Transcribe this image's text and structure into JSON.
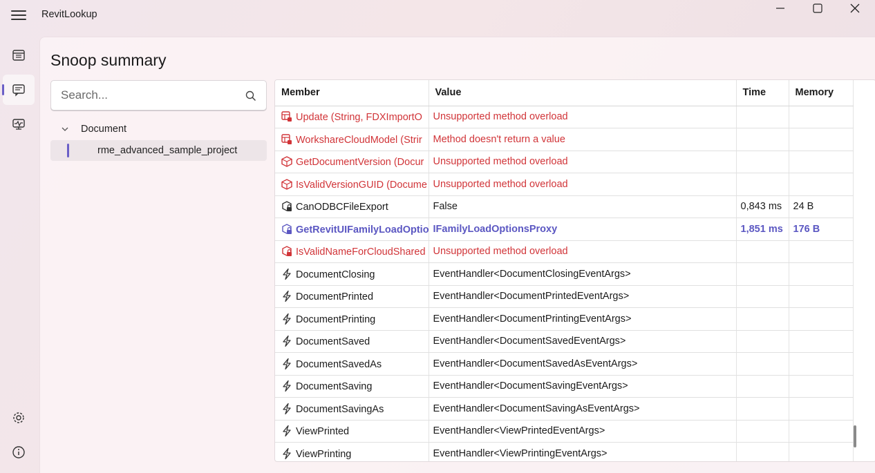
{
  "app": {
    "title": "RevitLookup"
  },
  "page": {
    "title": "Snoop summary"
  },
  "search": {
    "placeholder": "Search..."
  },
  "tree": {
    "root_label": "Document",
    "child_label": "rme_advanced_sample_project"
  },
  "table": {
    "columns": [
      "Member",
      "Value",
      "Time",
      "Memory"
    ],
    "rows": [
      {
        "icon": "method-error-icon",
        "member": "Update (String, FDXImportO",
        "value": "Unsupported method overload",
        "time": "",
        "memory": "",
        "state": "err"
      },
      {
        "icon": "method-error-icon",
        "member": "WorkshareCloudModel (Strir",
        "value": "Method doesn't return a value",
        "time": "",
        "memory": "",
        "state": "err"
      },
      {
        "icon": "static-method-error-icon",
        "member": "GetDocumentVersion (Docur",
        "value": "Unsupported method overload",
        "time": "",
        "memory": "",
        "state": "err"
      },
      {
        "icon": "static-method-error-icon",
        "member": "IsValidVersionGUID (Docume",
        "value": "Unsupported method overload",
        "time": "",
        "memory": "",
        "state": "err"
      },
      {
        "icon": "locked-method-icon",
        "member": "CanODBCFileExport",
        "value": "False",
        "time": "0,843 ms",
        "memory": "24 B",
        "state": "normal"
      },
      {
        "icon": "locked-method-icon",
        "member": "GetRevitUIFamilyLoadOptio",
        "value": "IFamilyLoadOptionsProxy",
        "time": "1,851 ms",
        "memory": "176 B",
        "state": "hl"
      },
      {
        "icon": "locked-method-icon",
        "member": "IsValidNameForCloudShared",
        "value": "Unsupported method overload",
        "time": "",
        "memory": "",
        "state": "err"
      },
      {
        "icon": "event-icon",
        "member": "DocumentClosing",
        "value": "EventHandler<DocumentClosingEventArgs>",
        "time": "",
        "memory": "",
        "state": "normal"
      },
      {
        "icon": "event-icon",
        "member": "DocumentPrinted",
        "value": "EventHandler<DocumentPrintedEventArgs>",
        "time": "",
        "memory": "",
        "state": "normal"
      },
      {
        "icon": "event-icon",
        "member": "DocumentPrinting",
        "value": "EventHandler<DocumentPrintingEventArgs>",
        "time": "",
        "memory": "",
        "state": "normal"
      },
      {
        "icon": "event-icon",
        "member": "DocumentSaved",
        "value": "EventHandler<DocumentSavedEventArgs>",
        "time": "",
        "memory": "",
        "state": "normal"
      },
      {
        "icon": "event-icon",
        "member": "DocumentSavedAs",
        "value": "EventHandler<DocumentSavedAsEventArgs>",
        "time": "",
        "memory": "",
        "state": "normal"
      },
      {
        "icon": "event-icon",
        "member": "DocumentSaving",
        "value": "EventHandler<DocumentSavingEventArgs>",
        "time": "",
        "memory": "",
        "state": "normal"
      },
      {
        "icon": "event-icon",
        "member": "DocumentSavingAs",
        "value": "EventHandler<DocumentSavingAsEventArgs>",
        "time": "",
        "memory": "",
        "state": "normal"
      },
      {
        "icon": "event-icon",
        "member": "ViewPrinted",
        "value": "EventHandler<ViewPrintedEventArgs>",
        "time": "",
        "memory": "",
        "state": "normal"
      },
      {
        "icon": "event-icon",
        "member": "ViewPrinting",
        "value": "EventHandler<ViewPrintingEventArgs>",
        "time": "",
        "memory": "",
        "state": "normal"
      }
    ]
  },
  "colors": {
    "accent": "#6a5fc7",
    "error": "#d13438",
    "highlight": "#5b57c2"
  },
  "nav": {
    "items": [
      "dashboard-icon",
      "snoop-summary-icon",
      "events-monitor-icon"
    ],
    "bottom": [
      "settings-icon",
      "about-icon"
    ]
  }
}
